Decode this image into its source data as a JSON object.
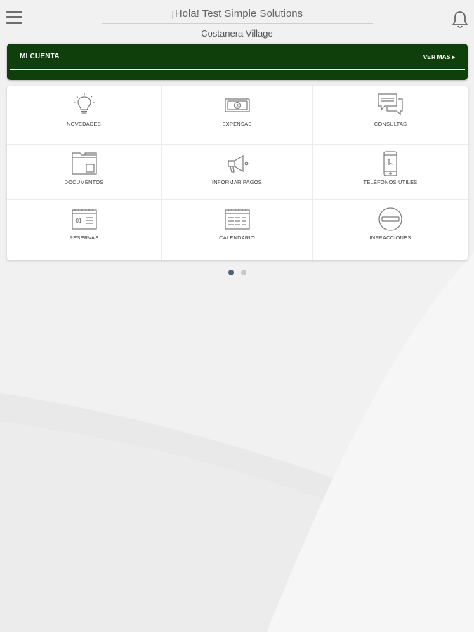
{
  "header": {
    "greeting": "¡Hola! Test Simple Solutions",
    "community": "Costanera Village",
    "menu_icon": "hamburger-menu-icon",
    "bell_icon": "bell-icon"
  },
  "account": {
    "title": "MI CUENTA",
    "more_label": "VER MAS ▸"
  },
  "menu_items": [
    {
      "label": "NOVEDADES",
      "icon": "lightbulb-icon"
    },
    {
      "label": "EXPENSAS",
      "icon": "banknote-icon"
    },
    {
      "label": "CONSULTAS",
      "icon": "chat-bubbles-icon"
    },
    {
      "label": "DOCUMENTOS",
      "icon": "folder-icon"
    },
    {
      "label": "INFORMAR PAGOS",
      "icon": "megaphone-icon"
    },
    {
      "label": "TELÉFONOS UTILES",
      "icon": "phone-icon"
    },
    {
      "label": "RESERVAS",
      "icon": "reservation-calendar-icon"
    },
    {
      "label": "CALENDARIO",
      "icon": "calendar-icon"
    },
    {
      "label": "INFRACCIONES",
      "icon": "no-entry-icon"
    }
  ],
  "pagination": {
    "pages": 2,
    "active": 1
  },
  "colors": {
    "brand_green": "#0f3f0b",
    "dot_active": "#4b6478",
    "dot_inactive": "#c8c8c8",
    "icon_stroke": "#7a7a7a"
  }
}
